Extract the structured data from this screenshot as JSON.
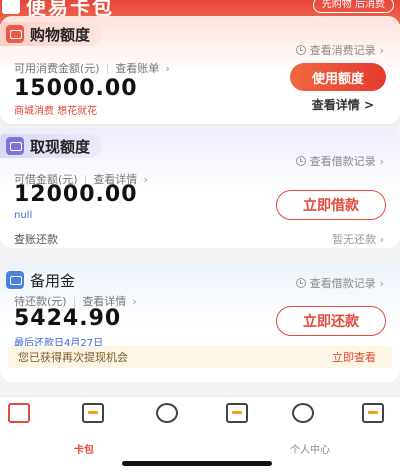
{
  "header": {
    "brand_title": "便易卡包",
    "pill_text": "先购物 后消费"
  },
  "shopping_card": {
    "title": "购物额度",
    "record_link": "查看消费记录",
    "available_label": "可用消费金额(元)",
    "bill_link": "查看账单",
    "amount": "15000.00",
    "slogan": "商城消费 想花就花",
    "use_button": "使用额度",
    "detail_link": "查看详情 >"
  },
  "cash_card": {
    "title": "取现额度",
    "record_link": "查看借款记录",
    "available_label": "可借金额(元)",
    "detail_link": "查看详情",
    "amount": "12000.00",
    "note": "null",
    "borrow_button": "立即借款",
    "repay_label": "查账还款",
    "no_repay_label": "暂无还款"
  },
  "reserve_card": {
    "title": "备用金",
    "record_link": "查看借款记录",
    "due_label": "待还款(元)",
    "detail_link": "查看详情",
    "amount": "5424.90",
    "last_date": "最后还款日4月27日",
    "repay_button": "立即还款",
    "notice_text": "您已获得再次提现机会",
    "notice_action": "立即查看"
  },
  "tabbar": {
    "tabs": [
      {
        "label": "卡包",
        "icon": "store-icon",
        "active": true
      },
      {
        "label": "",
        "icon": "card-icon",
        "active": false
      },
      {
        "label": "",
        "icon": "headset-icon",
        "active": false
      },
      {
        "label": "",
        "icon": "help-icon",
        "active": false
      },
      {
        "label": "",
        "icon": "gear-icon",
        "active": false
      },
      {
        "label": "个人中心",
        "icon": "edit-icon",
        "active": false
      }
    ]
  },
  "colors": {
    "brand_red": "#e24a3b",
    "link_blue": "#3b6ad6",
    "notice_bg": "#fdf6e6"
  }
}
